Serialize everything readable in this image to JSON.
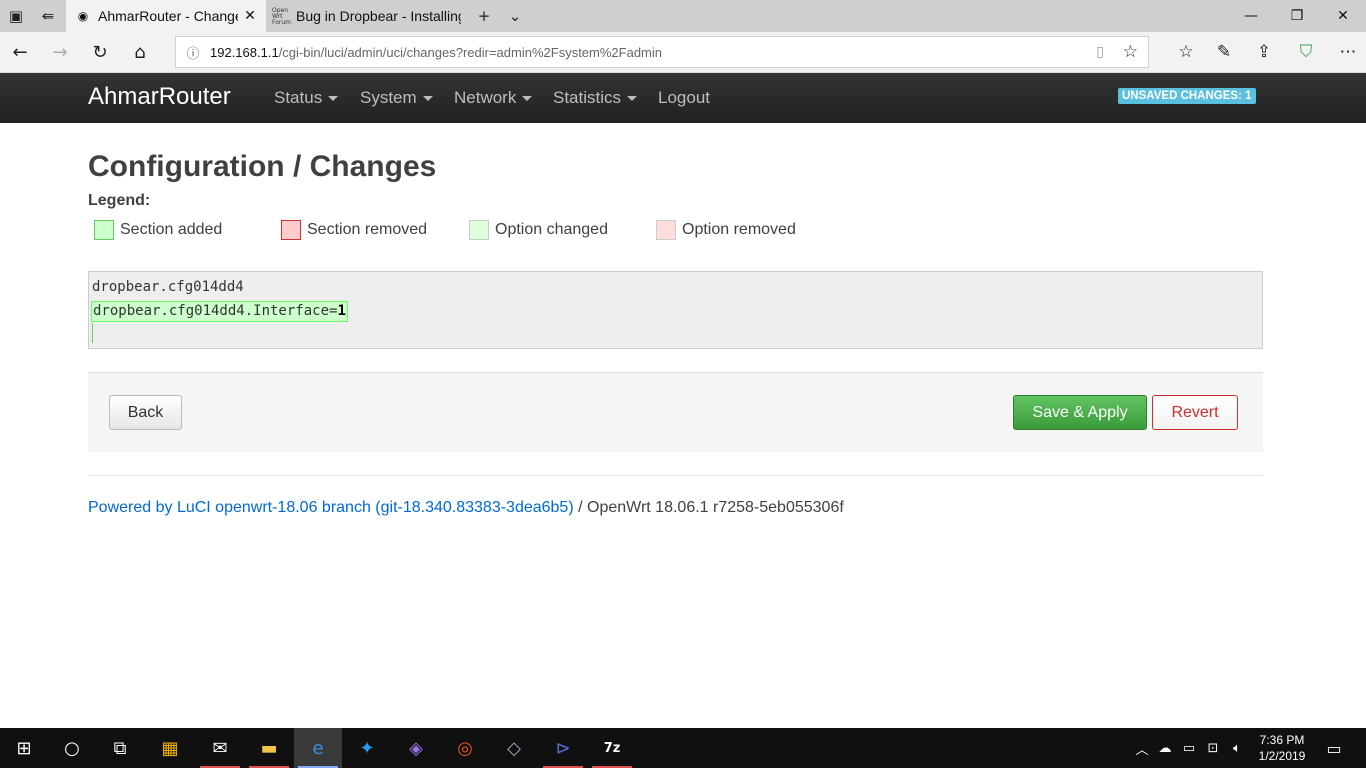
{
  "browser": {
    "tabs": [
      {
        "title": "AhmarRouter - Changes",
        "active": true,
        "favicon": "luci-icon"
      },
      {
        "title": "Bug in Dropbear - Installing",
        "active": false,
        "favicon": "openwrt-forum-icon",
        "favicon_text": "Open Wrt Forum"
      }
    ],
    "url": {
      "host": "192.168.1.1",
      "path": "/cgi-bin/luci/admin/uci/changes?redir=admin%2Fsystem%2Fadmin"
    }
  },
  "luci": {
    "brand": "AhmarRouter",
    "menu": [
      "Status",
      "System",
      "Network",
      "Statistics",
      "Logout"
    ],
    "unsaved_badge": "UNSAVED CHANGES: 1",
    "page_title": "Configuration / Changes",
    "legend_title": "Legend:",
    "legend": [
      {
        "label": "Section added",
        "fill": "#ccffcc",
        "border": "#66cc66"
      },
      {
        "label": "Section removed",
        "fill": "#ffcccc",
        "border": "#cc3333"
      },
      {
        "label": "Option changed",
        "fill": "#ddffdd",
        "border": "#cccccc"
      },
      {
        "label": "Option removed",
        "fill": "#ffdddd",
        "border": "#cccccc"
      }
    ],
    "changes": {
      "section": "dropbear.cfg014dd4",
      "option_key": "dropbear.cfg014dd4.Interface=",
      "option_value": "1"
    },
    "buttons": {
      "back": "Back",
      "save_apply": "Save & Apply",
      "revert": "Revert"
    },
    "footer": {
      "link": "Powered by LuCI openwrt-18.06 branch (git-18.340.83383-3dea6b5)",
      "separator": " / ",
      "version": "OpenWrt 18.06.1 r7258-5eb055306f"
    }
  },
  "taskbar": {
    "clock_time": "7:36 PM",
    "clock_date": "1/2/2019"
  }
}
